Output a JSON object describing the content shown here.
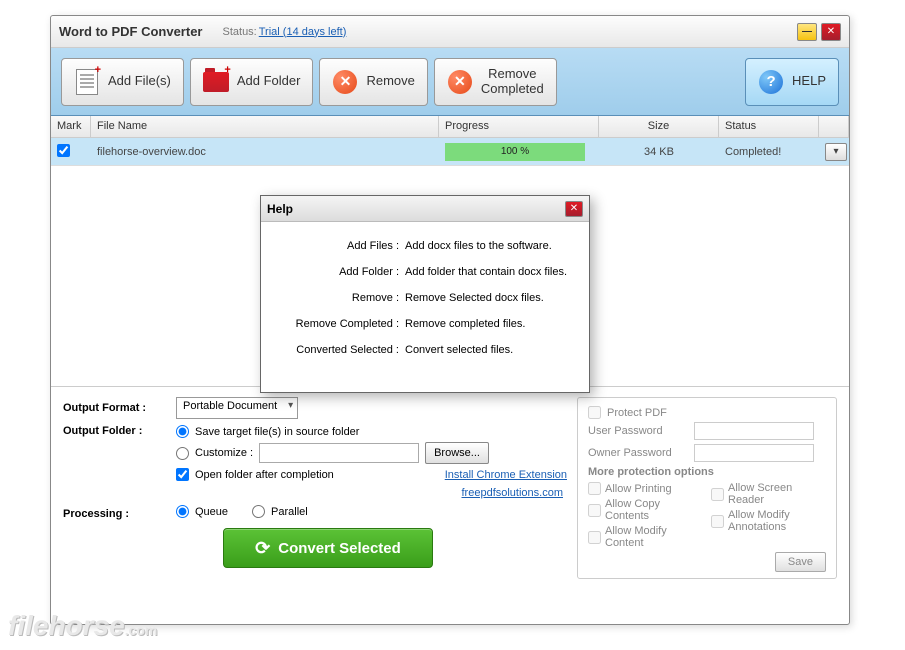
{
  "window": {
    "title": "Word to PDF Converter",
    "status_label": "Status:",
    "status_link": "Trial (14 days left)"
  },
  "toolbar": {
    "add_files": "Add File(s)",
    "add_folder": "Add Folder",
    "remove": "Remove",
    "remove_completed": "Remove\nCompleted",
    "help": "HELP"
  },
  "table": {
    "headers": {
      "mark": "Mark",
      "name": "File Name",
      "progress": "Progress",
      "size": "Size",
      "status": "Status"
    },
    "rows": [
      {
        "name": "filehorse-overview.doc",
        "progress": "100 %",
        "size": "34 KB",
        "status": "Completed!",
        "checked": true
      }
    ]
  },
  "options": {
    "output_format_label": "Output Format :",
    "output_format_value": "Portable Document",
    "output_folder_label": "Output Folder :",
    "save_in_source": "Save target file(s) in source folder",
    "customize": "Customize :",
    "browse": "Browse...",
    "open_after": "Open folder after completion",
    "install_ext": "Install Chrome Extension",
    "site_link": "freepdfsolutions.com",
    "processing_label": "Processing :",
    "queue": "Queue",
    "parallel": "Parallel",
    "convert": "Convert Selected"
  },
  "protect": {
    "title": "Protect PDF",
    "user_pw": "User Password",
    "owner_pw": "Owner Password",
    "more": "More protection options",
    "allow_printing": "Allow Printing",
    "allow_copy": "Allow Copy Contents",
    "allow_modify": "Allow Modify Content",
    "allow_screen": "Allow Screen Reader",
    "allow_annot": "Allow Modify Annotations",
    "save": "Save"
  },
  "help_dialog": {
    "title": "Help",
    "rows": [
      {
        "k": "Add Files  :",
        "v": "Add docx files to the software."
      },
      {
        "k": "Add Folder  :",
        "v": "Add folder that contain docx files."
      },
      {
        "k": "Remove  :",
        "v": "Remove Selected docx files."
      },
      {
        "k": "Remove Completed  :",
        "v": "Remove completed files."
      },
      {
        "k": "Converted Selected  :",
        "v": "Convert selected files."
      }
    ]
  },
  "watermark": {
    "brand": "filehorse",
    "suffix": ".com"
  }
}
